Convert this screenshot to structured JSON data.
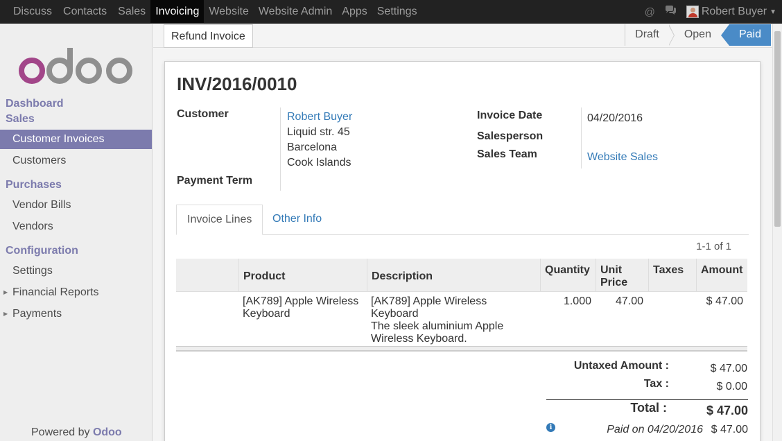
{
  "topbar": {
    "menu": [
      "Discuss",
      "Contacts",
      "Sales",
      "Invoicing",
      "Website",
      "Website Admin",
      "Apps",
      "Settings"
    ],
    "active_index": 3,
    "user_name": "Robert Buyer"
  },
  "sidebar": {
    "sections": [
      {
        "title": "Dashboard"
      },
      {
        "title": "Sales",
        "items": [
          "Customer Invoices",
          "Customers"
        ]
      },
      {
        "title": "Purchases",
        "items": [
          "Vendor Bills",
          "Vendors"
        ]
      },
      {
        "title": "Configuration",
        "items": [
          "Settings",
          "Financial Reports",
          "Payments"
        ]
      }
    ],
    "active_item": "Customer Invoices",
    "powered_prefix": "Powered by ",
    "powered_brand": "Odoo"
  },
  "toolbar": {
    "refund_label": "Refund Invoice",
    "steps": [
      "Draft",
      "Open",
      "Paid"
    ],
    "active_step": "Paid"
  },
  "invoice": {
    "number": "INV/2016/0010",
    "customer_label": "Customer",
    "customer_name": "Robert Buyer",
    "address": [
      "Liquid str. 45",
      "Barcelona",
      "Cook Islands"
    ],
    "payment_term_label": "Payment Term",
    "invoice_date_label": "Invoice Date",
    "invoice_date": "04/20/2016",
    "salesperson_label": "Salesperson",
    "sales_team_label": "Sales Team",
    "sales_team": "Website Sales"
  },
  "tabs": [
    "Invoice Lines",
    "Other Info"
  ],
  "pager": "1-1 of 1",
  "table": {
    "headers": {
      "product": "Product",
      "description": "Description",
      "quantity": "Quantity",
      "unit_price_1": "Unit",
      "unit_price_2": "Price",
      "taxes": "Taxes",
      "amount": "Amount"
    },
    "rows": [
      {
        "product": [
          "[AK789] Apple Wireless",
          "Keyboard"
        ],
        "description": [
          "[AK789] Apple Wireless",
          "Keyboard",
          "The sleek aluminium Apple",
          "Wireless Keyboard."
        ],
        "quantity": "1.000",
        "unit_price": "47.00",
        "taxes": "",
        "amount": "$ 47.00"
      }
    ]
  },
  "totals": {
    "untaxed_label": "Untaxed Amount :",
    "untaxed_value": "$ 47.00",
    "tax_label": "Tax :",
    "tax_value": "$ 0.00",
    "total_label": "Total :",
    "total_value": "$ 47.00",
    "paid_text": "Paid on 04/20/2016",
    "paid_value": "$ 47.00"
  },
  "colors": {
    "brand": "#7c7bad",
    "link": "#337ab7",
    "paid_step": "#4a8bc7"
  }
}
